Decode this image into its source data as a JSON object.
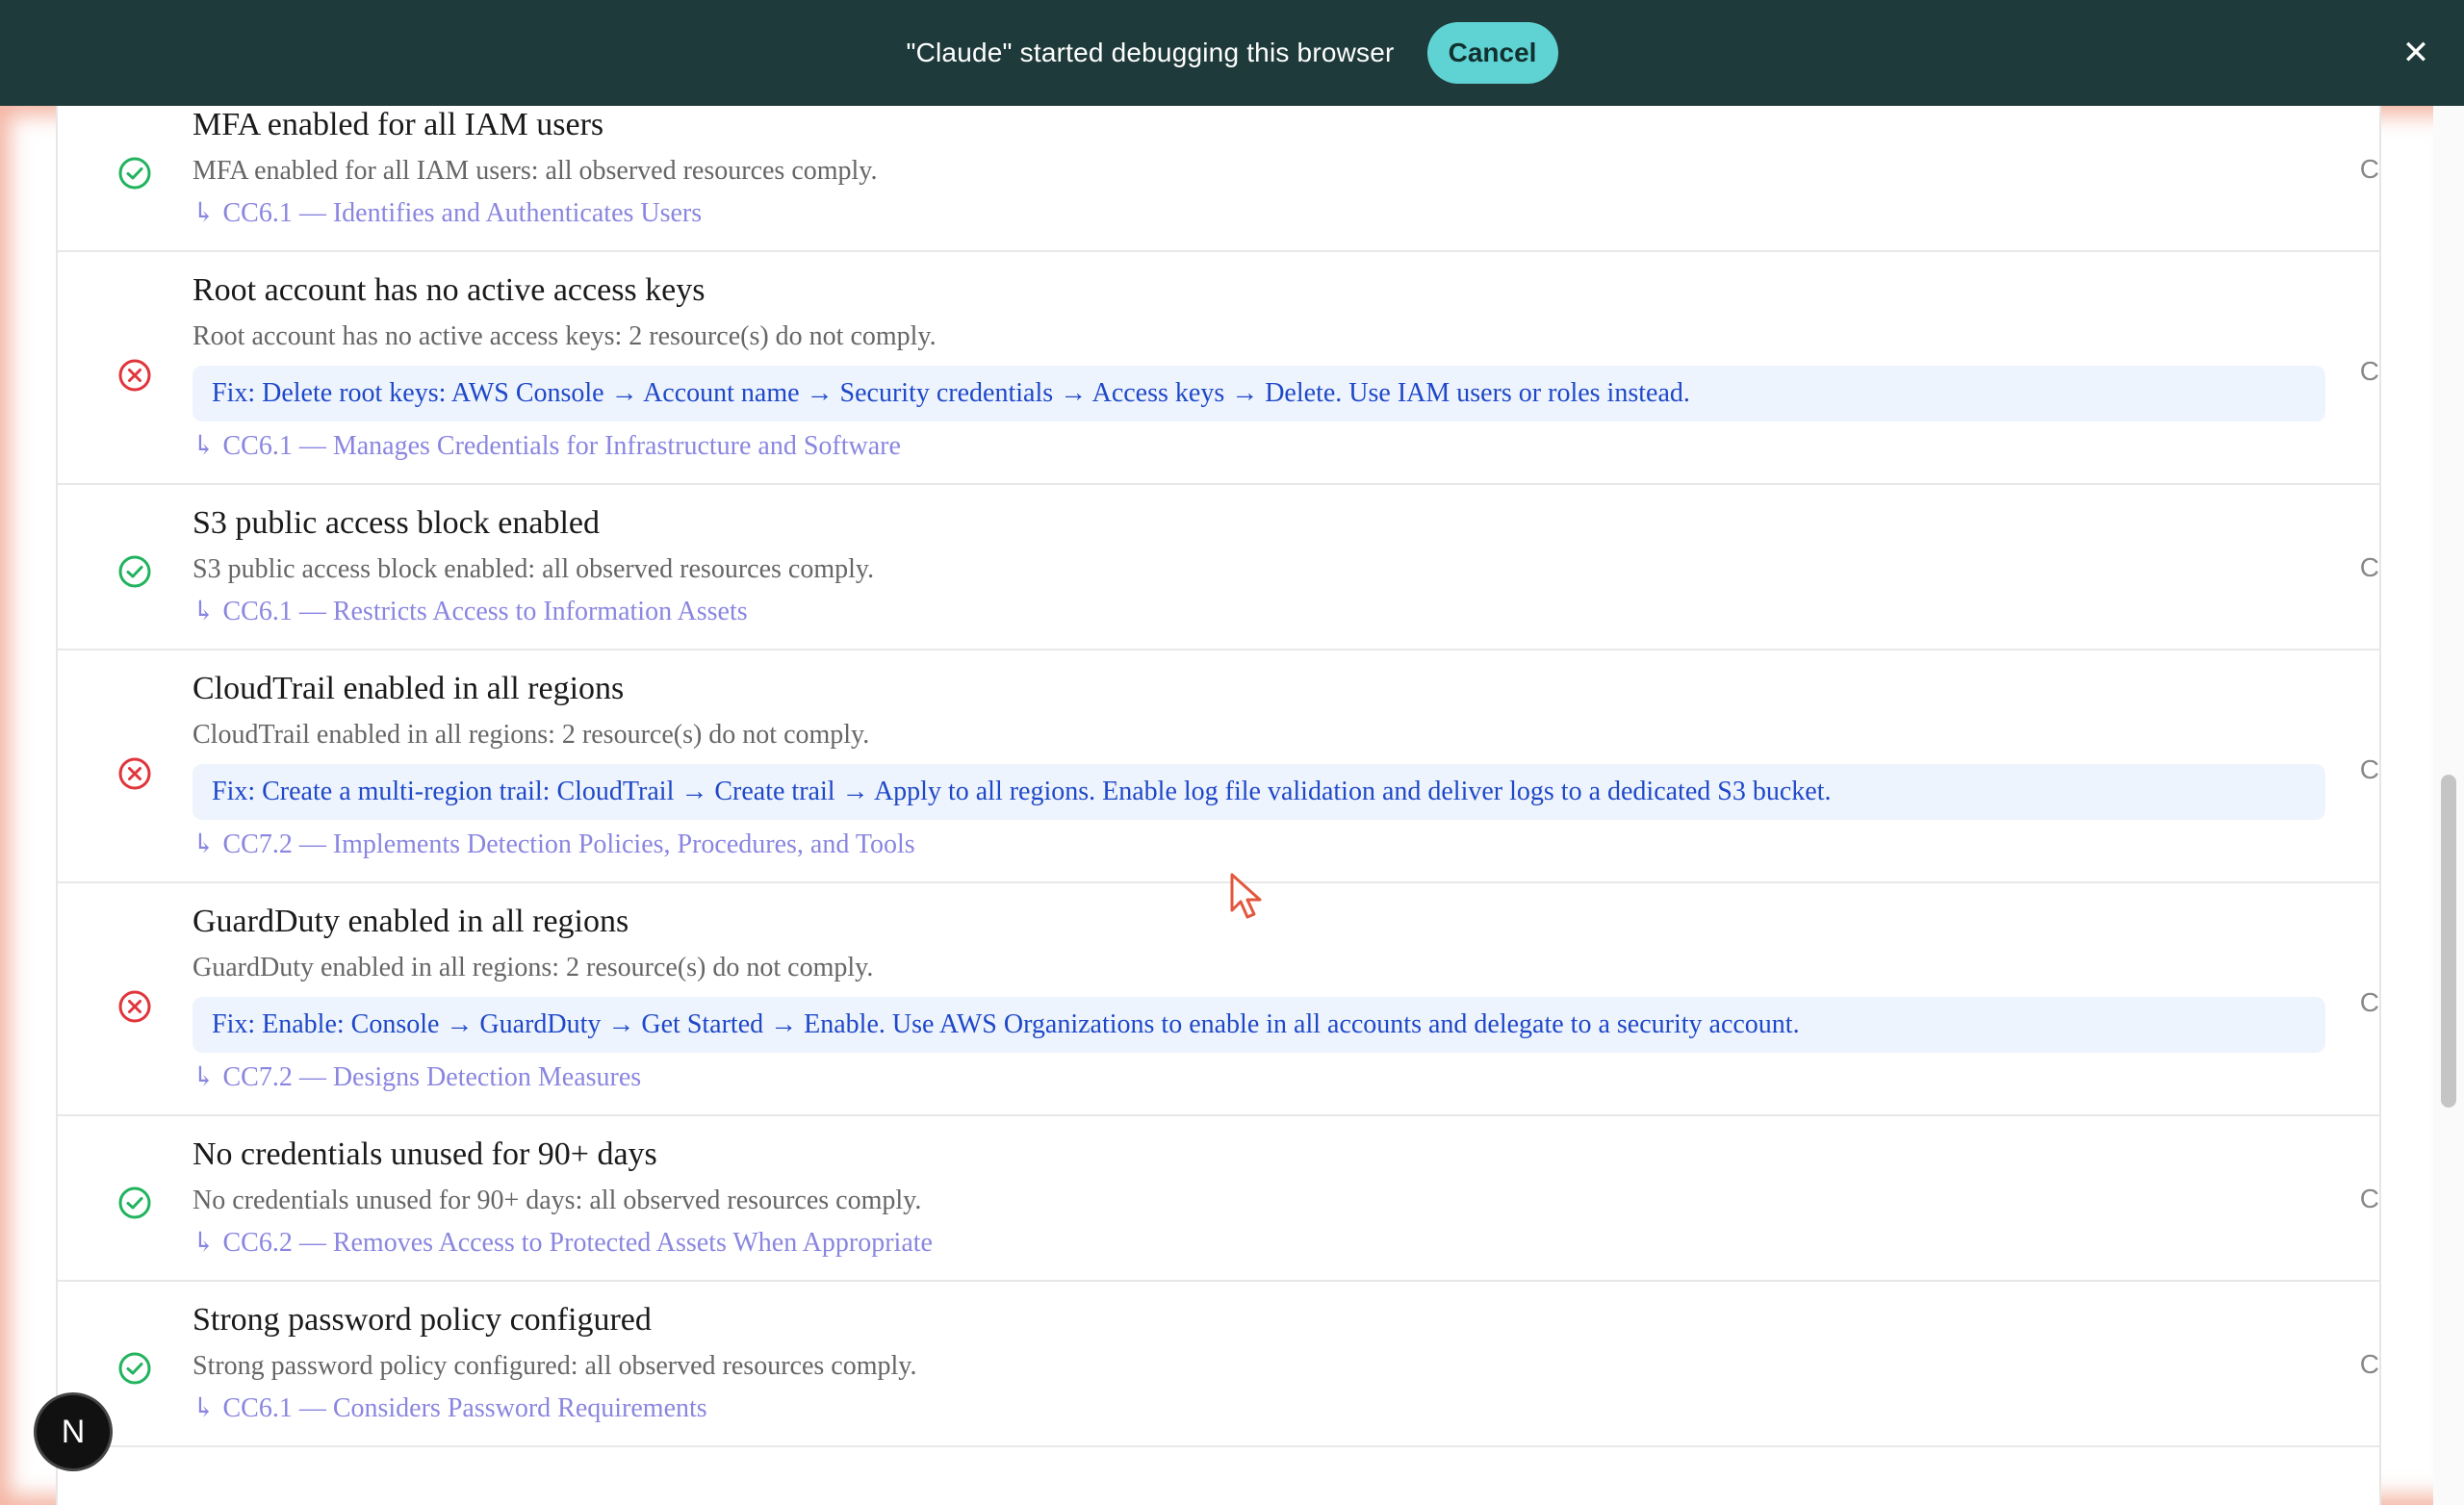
{
  "banner": {
    "message": "\"Claude\" started debugging this browser",
    "cancel_label": "Cancel",
    "close_glyph": "✕"
  },
  "checks": [
    {
      "status": "pass",
      "title": "MFA enabled for all IAM users",
      "description": "MFA enabled for all IAM users: all observed resources comply.",
      "fix": "",
      "control": "CC6.1 — Identifies and Authenticates Users",
      "right_text": "C"
    },
    {
      "status": "fail",
      "title": "Root account has no active access keys",
      "description": "Root account has no active access keys: 2 resource(s) do not comply.",
      "fix": "Fix: Delete root keys: AWS Console → Account name → Security credentials → Access keys → Delete. Use IAM users or roles instead.",
      "control": "CC6.1 — Manages Credentials for Infrastructure and Software",
      "right_text": "C"
    },
    {
      "status": "pass",
      "title": "S3 public access block enabled",
      "description": "S3 public access block enabled: all observed resources comply.",
      "fix": "",
      "control": "CC6.1 — Restricts Access to Information Assets",
      "right_text": "C"
    },
    {
      "status": "fail",
      "title": "CloudTrail enabled in all regions",
      "description": "CloudTrail enabled in all regions: 2 resource(s) do not comply.",
      "fix": "Fix: Create a multi-region trail: CloudTrail → Create trail → Apply to all regions. Enable log file validation and deliver logs to a dedicated S3 bucket.",
      "control": "CC7.2 — Implements Detection Policies, Procedures, and Tools",
      "right_text": "C"
    },
    {
      "status": "fail",
      "title": "GuardDuty enabled in all regions",
      "description": "GuardDuty enabled in all regions: 2 resource(s) do not comply.",
      "fix": "Fix: Enable: Console → GuardDuty → Get Started → Enable. Use AWS Organizations to enable in all accounts and delegate to a security account.",
      "control": "CC7.2 — Designs Detection Measures",
      "right_text": "C"
    },
    {
      "status": "pass",
      "title": "No credentials unused for 90+ days",
      "description": "No credentials unused for 90+ days: all observed resources comply.",
      "fix": "",
      "control": "CC6.2 — Removes Access to Protected Assets When Appropriate",
      "right_text": "C"
    },
    {
      "status": "pass",
      "title": "Strong password policy configured",
      "description": "Strong password policy configured: all observed resources comply.",
      "fix": "",
      "control": "CC6.1 — Considers Password Requirements",
      "right_text": "C"
    }
  ],
  "link_arrow": "↳",
  "avatar_initial": "N",
  "colors": {
    "pass": "#22b35e",
    "fail": "#e0353b",
    "banner_bg": "#1f3a3a",
    "accent": "#5fd3d3",
    "link": "#8a86e0",
    "fix_text": "#1f48c8"
  },
  "icons": {
    "pass": "check-circle-icon",
    "fail": "x-circle-icon",
    "close": "close-icon",
    "cursor": "mouse-pointer-icon"
  }
}
